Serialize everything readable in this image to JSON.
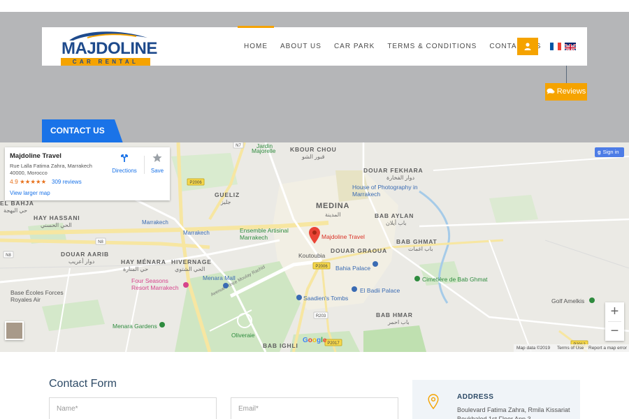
{
  "brand": {
    "logo_word": "MAJDOLINE",
    "logo_sub": "CAR RENTAL",
    "primary_color": "#1e4a8c",
    "accent_color": "#f5a300"
  },
  "nav": {
    "items": [
      {
        "label": "HOME",
        "active": true
      },
      {
        "label": "ABOUT US",
        "active": false
      },
      {
        "label": "CAR PARK",
        "active": false
      },
      {
        "label": "TERMS & CONDITIONS",
        "active": false
      },
      {
        "label": "CONTACT US",
        "active": false
      }
    ],
    "user_icon": "user-icon",
    "languages": [
      "french-flag",
      "english-flag"
    ]
  },
  "reviews_button": {
    "label": "Reviews",
    "icon": "comments-icon"
  },
  "page_tab": {
    "label": "CONTACT US",
    "color": "#1a73e8"
  },
  "map": {
    "info_card": {
      "title": "Majdoline Travel",
      "address": "Rue Lalla Fatima Zahra, Marrakech 40000, Morocco",
      "rating": "4.9 ★★★★★",
      "reviews": "309 reviews",
      "larger_map": "View larger map",
      "directions": "Directions",
      "save": "Save"
    },
    "sign_in": "Sign in",
    "marker_label": "Majdoline Travel",
    "district_labels": {
      "kbour_chou": "KBOUR CHOU",
      "kbour_chou_ar": "قبور الشو",
      "jardin": "Jardin",
      "majorelle": "Majorelle",
      "douar_fekhara": "DOUAR FEKHARA",
      "douar_fekhara_ar": "دوار الفخارة",
      "gueliz": "GUELIZ",
      "gueliz_ar": "جليز",
      "medina": "MEDINA",
      "medina_ar": "المدينة",
      "bab_aylan": "BAB AYLAN",
      "bab_aylan_ar": "باب أيلان",
      "el_bahja": "EL BAHJA",
      "el_bahja_ar": "حي البهجة",
      "hay_hassani": "HAY HASSANI",
      "hay_hassani_ar": "الحي الحسني",
      "bab_ghmat": "BAB GHMAT",
      "bab_ghmat_ar": "باب اغمات",
      "douar_graoua": "DOUAR GRAOUA",
      "douar_aarib": "DOUAR AARIB",
      "douar_aarib_ar": "دوار أعريب",
      "hay_menara": "HAY MÉNARA",
      "hay_menara_ar": "حي المنارة",
      "hivernage": "HIVERNAGE",
      "hivernage_ar": "الحي الشتوي",
      "bab_hmar": "BAB HMAR",
      "bab_hmar_ar": "باب احمر",
      "bab_ighli": "BAB IGHLI"
    },
    "poi_labels": {
      "house_photo": "House of Photography in Marrakech",
      "ensemble": "Ensemble Artisinal Marrakech",
      "koutoubia": "Koutoubia",
      "bahia": "Bahia Palace",
      "badii": "El Badii Palace",
      "cimetiere": "Cimetière de Bab Ghmat",
      "menara_mall": "Menara Mall",
      "four_seasons": "Four Seasons Resort Marrakech",
      "saadiens": "Saadien's Tombs",
      "base_ecoles": "Base Écoles Forces Royales Air",
      "menara_gardens": "Menara Gardens",
      "oliveraie": "Oliveraie",
      "golf": "Golf Amelkis",
      "avenue": "Avenue Prince Moulay Rachid",
      "marrakech_left": "Marrakech",
      "marrakech_mid": "Marrakech"
    },
    "road_badges": {
      "n7": "N7",
      "p2006_a": "P2006",
      "p2006_b": "P2006",
      "n8_a": "N8",
      "n8_b": "N8",
      "r203": "R203",
      "p2017": "P2017",
      "p2012": "P2012"
    },
    "google": "Google",
    "footer": {
      "data": "Map data ©2019",
      "terms": "Terms of Use",
      "report": "Report a map error"
    }
  },
  "contact_form": {
    "title": "Contact Form",
    "name_placeholder": "Name*",
    "email_placeholder": "Email*"
  },
  "address": {
    "title": "ADDRESS",
    "text": "Boulevard Fatima Zahra, Rmila Kissariat Boukhaled 1st Floor App 3"
  }
}
